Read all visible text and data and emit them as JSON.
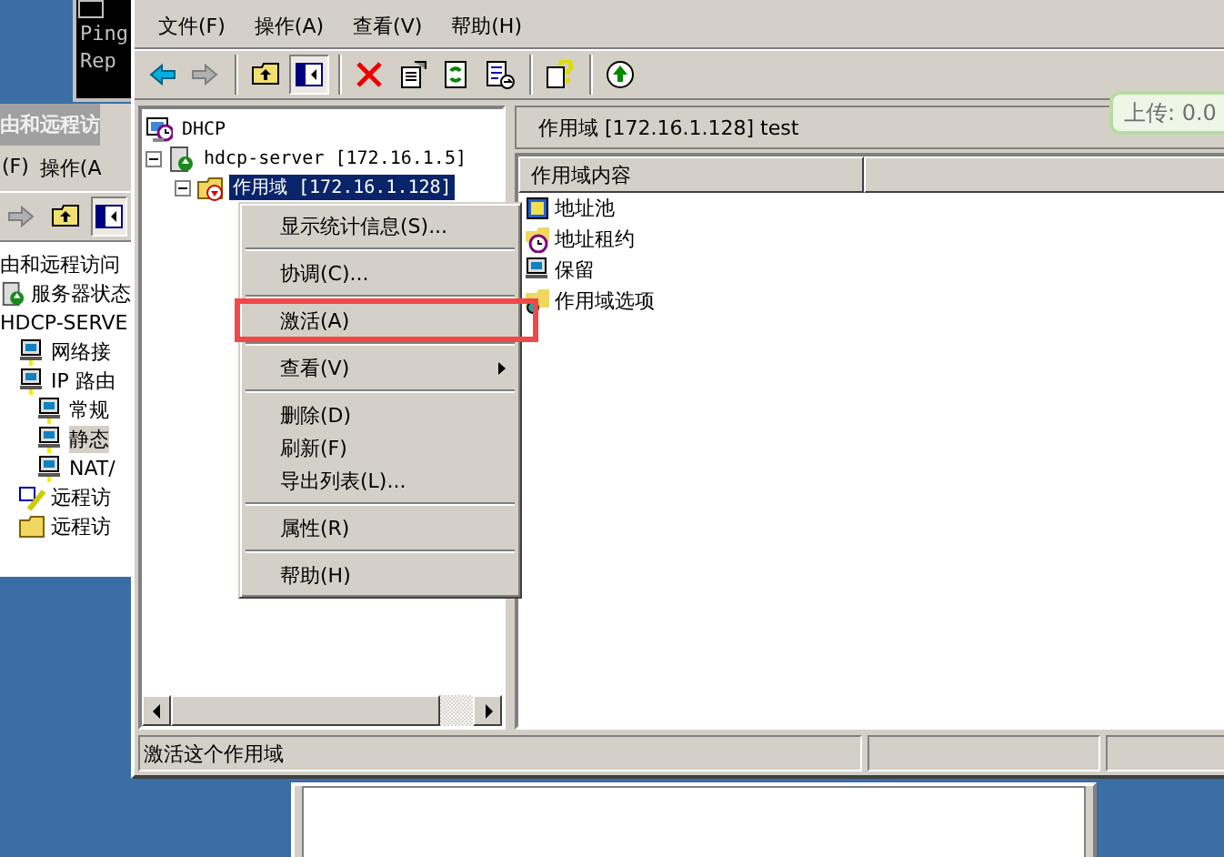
{
  "cmd_window": {
    "lines": [
      "Ping",
      "Rep"
    ]
  },
  "routing_window": {
    "title": "由和远程访",
    "menu": [
      "(F)",
      "操作(A"
    ],
    "toolbar": [
      {
        "kind": "forward",
        "pressed": false
      },
      {
        "kind": "up",
        "pressed": false
      },
      {
        "kind": "tree",
        "pressed": true
      }
    ],
    "tree": [
      {
        "label": "由和远程访问",
        "selected": false,
        "children": [
          {
            "label": "服务器状态",
            "kind": "server",
            "selected": false
          },
          {
            "label": "HDCP-SERVE",
            "kind": "none",
            "selected": false,
            "children": [
              {
                "label": "网络接",
                "kind": "network",
                "selected": false
              },
              {
                "label": "IP 路由",
                "kind": "network",
                "selected": false,
                "children": [
                  {
                    "label": "常规",
                    "kind": "network",
                    "selected": false
                  },
                  {
                    "label": "静态",
                    "kind": "network",
                    "selected": true
                  },
                  {
                    "label": "NAT/",
                    "kind": "network",
                    "selected": false
                  }
                ]
              },
              {
                "label": "远程访",
                "kind": "policy",
                "selected": false
              },
              {
                "label": "远程访",
                "kind": "folder",
                "selected": false
              }
            ]
          }
        ]
      }
    ]
  },
  "window": {
    "menu": [
      "文件(F)",
      "操作(A)",
      "查看(V)",
      "帮助(H)"
    ],
    "toolbar": [
      [
        {
          "kind": "back",
          "pressed": false
        },
        {
          "kind": "forward",
          "pressed": false
        }
      ],
      [
        {
          "kind": "up",
          "pressed": false
        },
        {
          "kind": "tree",
          "pressed": true
        }
      ],
      [
        {
          "kind": "delete",
          "pressed": false
        },
        {
          "kind": "properties",
          "pressed": false
        },
        {
          "kind": "refresh",
          "pressed": false
        },
        {
          "kind": "export",
          "pressed": false
        }
      ],
      [
        {
          "kind": "help",
          "pressed": false
        }
      ],
      [
        {
          "kind": "start",
          "pressed": false
        }
      ]
    ],
    "tree": [
      {
        "label": "DHCP",
        "kind": "dhcp",
        "selected": false,
        "children": [
          {
            "label": "hdcp-server [172.16.1.5]",
            "kind": "server",
            "selected": false,
            "expanded": true,
            "children": [
              {
                "label": "作用域 [172.16.1.128]",
                "kind": "scope",
                "selected": true,
                "expanded": true
              }
            ]
          }
        ]
      }
    ],
    "pane_title": "作用域 [172.16.1.128] test",
    "columns": [
      "作用域内容"
    ],
    "items": [
      {
        "label": "地址池",
        "kind": "pool"
      },
      {
        "label": "地址租约",
        "kind": "lease"
      },
      {
        "label": "保留",
        "kind": "reservation"
      },
      {
        "label": "作用域选项",
        "kind": "options"
      }
    ],
    "status": "激活这个作用域"
  },
  "context_menu": [
    {
      "kind": "item",
      "label": "显示统计信息(S)...",
      "submenu": false,
      "highlighted": false
    },
    {
      "kind": "separator"
    },
    {
      "kind": "item",
      "label": "协调(C)...",
      "submenu": false,
      "highlighted": false
    },
    {
      "kind": "separator"
    },
    {
      "kind": "item",
      "label": "激活(A)",
      "submenu": false,
      "highlighted": true
    },
    {
      "kind": "separator"
    },
    {
      "kind": "item",
      "label": "查看(V)",
      "submenu": true,
      "highlighted": false
    },
    {
      "kind": "separator"
    },
    {
      "kind": "item",
      "label": "删除(D)",
      "submenu": false,
      "highlighted": false
    },
    {
      "kind": "item",
      "label": "刷新(F)",
      "submenu": false,
      "highlighted": false
    },
    {
      "kind": "item",
      "label": "导出列表(L)...",
      "submenu": false,
      "highlighted": false
    },
    {
      "kind": "separator"
    },
    {
      "kind": "item",
      "label": "属性(R)",
      "submenu": false,
      "highlighted": false
    },
    {
      "kind": "separator"
    },
    {
      "kind": "item",
      "label": "帮助(H)",
      "submenu": false,
      "highlighted": false
    }
  ],
  "tooltip": "上传: 0.0"
}
